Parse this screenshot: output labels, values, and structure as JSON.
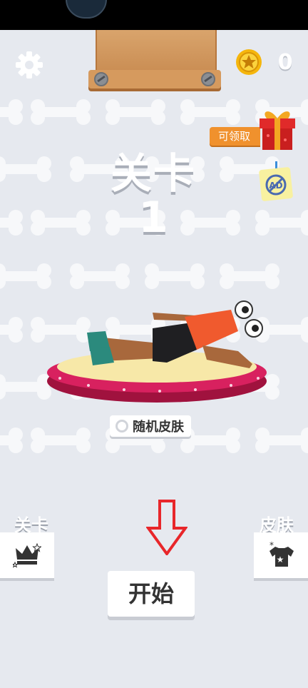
{
  "header": {
    "coin_count": "0"
  },
  "gift": {
    "claim_label": "可领取"
  },
  "level": {
    "title": "关卡",
    "number": "1"
  },
  "skin": {
    "random_label": "随机皮肤"
  },
  "nav": {
    "levels_label": "关卡",
    "skins_label": "皮肤"
  },
  "start": {
    "label": "开始"
  },
  "icons": [
    "gear-icon",
    "coin-icon",
    "gift-icon",
    "no-ads-icon",
    "crown-icon",
    "tshirt-icon",
    "down-arrow-icon"
  ],
  "colors": {
    "background": "#e6e9ef",
    "accent_orange": "#f0912d",
    "arrow_red": "#e8262a",
    "stage_pink": "#d8215f",
    "stage_cream": "#f7e8a8"
  }
}
